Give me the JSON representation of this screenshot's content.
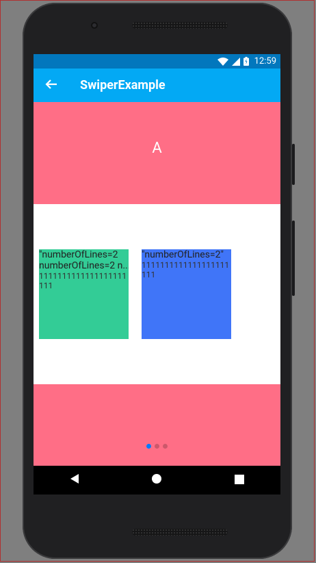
{
  "status_bar": {
    "time": "12:59",
    "icons": [
      "wifi-icon",
      "signal-icon",
      "battery-icon"
    ]
  },
  "app_bar": {
    "title": "SwiperExample",
    "back_icon": "arrow-back-icon"
  },
  "slide": {
    "label": "A",
    "background": "#ff6e86"
  },
  "cards": [
    {
      "line1": "\"numberOfLines=2",
      "line1b": "numberOfLines=2 n...",
      "line2": "1111111111111111111111",
      "color": "#33cc96"
    },
    {
      "line1": "\"numberOfLines=2\"",
      "line2": "1111111111111111111111",
      "color": "#4075f8"
    }
  ],
  "pagination": {
    "count": 3,
    "active_index": 0,
    "active_color": "#007aff"
  },
  "nav_bar": {
    "buttons": [
      "back-triangle-icon",
      "home-circle-icon",
      "recents-square-icon"
    ]
  }
}
